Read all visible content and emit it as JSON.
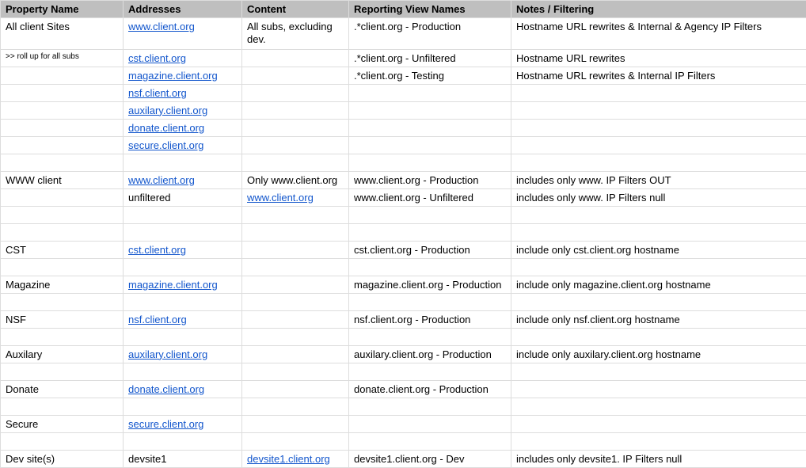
{
  "headers": {
    "property": "Property Name",
    "addresses": "Addresses",
    "content": "Content",
    "reporting": "Reporting View Names",
    "notes": "Notes / Filtering"
  },
  "rows": [
    {
      "property": "All client Sites",
      "addresses": "www.client.org",
      "addresses_link": true,
      "content": "All subs, excluding dev.",
      "content_wrap": true,
      "reporting": ".*client.org - Production",
      "notes": "Hostname URL rewrites & Internal & Agency IP Filters"
    },
    {
      "property": ">> roll up for all subs",
      "property_small": true,
      "addresses": "cst.client.org",
      "addresses_link": true,
      "content": "",
      "reporting": ".*client.org - Unfiltered",
      "notes": "Hostname URL rewrites"
    },
    {
      "property": "",
      "addresses": "magazine.client.org",
      "addresses_link": true,
      "content": "",
      "reporting": ".*client.org - Testing",
      "notes": "Hostname URL rewrites & Internal IP Filters"
    },
    {
      "property": "",
      "addresses": "nsf.client.org",
      "addresses_link": true,
      "content": "",
      "reporting": "",
      "notes": ""
    },
    {
      "property": "",
      "addresses": "auxilary.client.org",
      "addresses_link": true,
      "content": "",
      "reporting": "",
      "notes": ""
    },
    {
      "property": "",
      "addresses": "donate.client.org",
      "addresses_link": true,
      "content": "",
      "reporting": "",
      "notes": ""
    },
    {
      "property": "",
      "addresses": "secure.client.org",
      "addresses_link": true,
      "content": "",
      "reporting": "",
      "notes": ""
    },
    {
      "property": "",
      "addresses": "",
      "content": "",
      "reporting": "",
      "notes": ""
    },
    {
      "property": "WWW client",
      "addresses": "www.client.org",
      "addresses_link": true,
      "content": "Only www.client.org",
      "reporting": "www.client.org - Production",
      "notes": "includes only www. IP Filters OUT"
    },
    {
      "property": "",
      "addresses": "unfiltered",
      "content": "www.client.org",
      "content_link": true,
      "reporting": "www.client.org - Unfiltered",
      "notes": "includes only www. IP Filters null"
    },
    {
      "property": "",
      "addresses": "",
      "content": "",
      "reporting": "",
      "notes": ""
    },
    {
      "property": "",
      "addresses": "",
      "content": "",
      "reporting": "",
      "notes": ""
    },
    {
      "property": "CST",
      "addresses": "cst.client.org",
      "addresses_link": true,
      "content": "",
      "reporting": "cst.client.org - Production",
      "notes": "include only cst.client.org hostname"
    },
    {
      "property": "",
      "addresses": "",
      "content": "",
      "reporting": "",
      "notes": ""
    },
    {
      "property": "Magazine",
      "addresses": "magazine.client.org",
      "addresses_link": true,
      "content": "",
      "reporting": "magazine.client.org - Production",
      "notes": "include only magazine.client.org hostname"
    },
    {
      "property": "",
      "addresses": "",
      "content": "",
      "reporting": "",
      "notes": ""
    },
    {
      "property": "NSF",
      "addresses": "nsf.client.org",
      "addresses_link": true,
      "content": "",
      "reporting": "nsf.client.org - Production",
      "notes": "include only nsf.client.org hostname"
    },
    {
      "property": "",
      "addresses": "",
      "content": "",
      "reporting": "",
      "notes": ""
    },
    {
      "property": "Auxilary",
      "addresses": "auxilary.client.org",
      "addresses_link": true,
      "content": "",
      "reporting": "auxilary.client.org - Production",
      "notes": "include only auxilary.client.org hostname"
    },
    {
      "property": "",
      "addresses": "",
      "content": "",
      "reporting": "",
      "notes": ""
    },
    {
      "property": "Donate",
      "addresses": "donate.client.org",
      "addresses_link": true,
      "content": "",
      "reporting": "donate.client.org - Production",
      "notes": ""
    },
    {
      "property": "",
      "addresses": "",
      "content": "",
      "reporting": "",
      "notes": ""
    },
    {
      "property": "Secure",
      "addresses": "secure.client.org",
      "addresses_link": true,
      "content": "",
      "reporting": "",
      "notes": ""
    },
    {
      "property": "",
      "addresses": "",
      "content": "",
      "reporting": "",
      "notes": ""
    },
    {
      "property": "Dev site(s)",
      "addresses": "devsite1",
      "content": "devsite1.client.org",
      "content_link": true,
      "reporting": "devsite1.client.org - Dev",
      "notes": "includes only devsite1. IP Filters null"
    }
  ]
}
